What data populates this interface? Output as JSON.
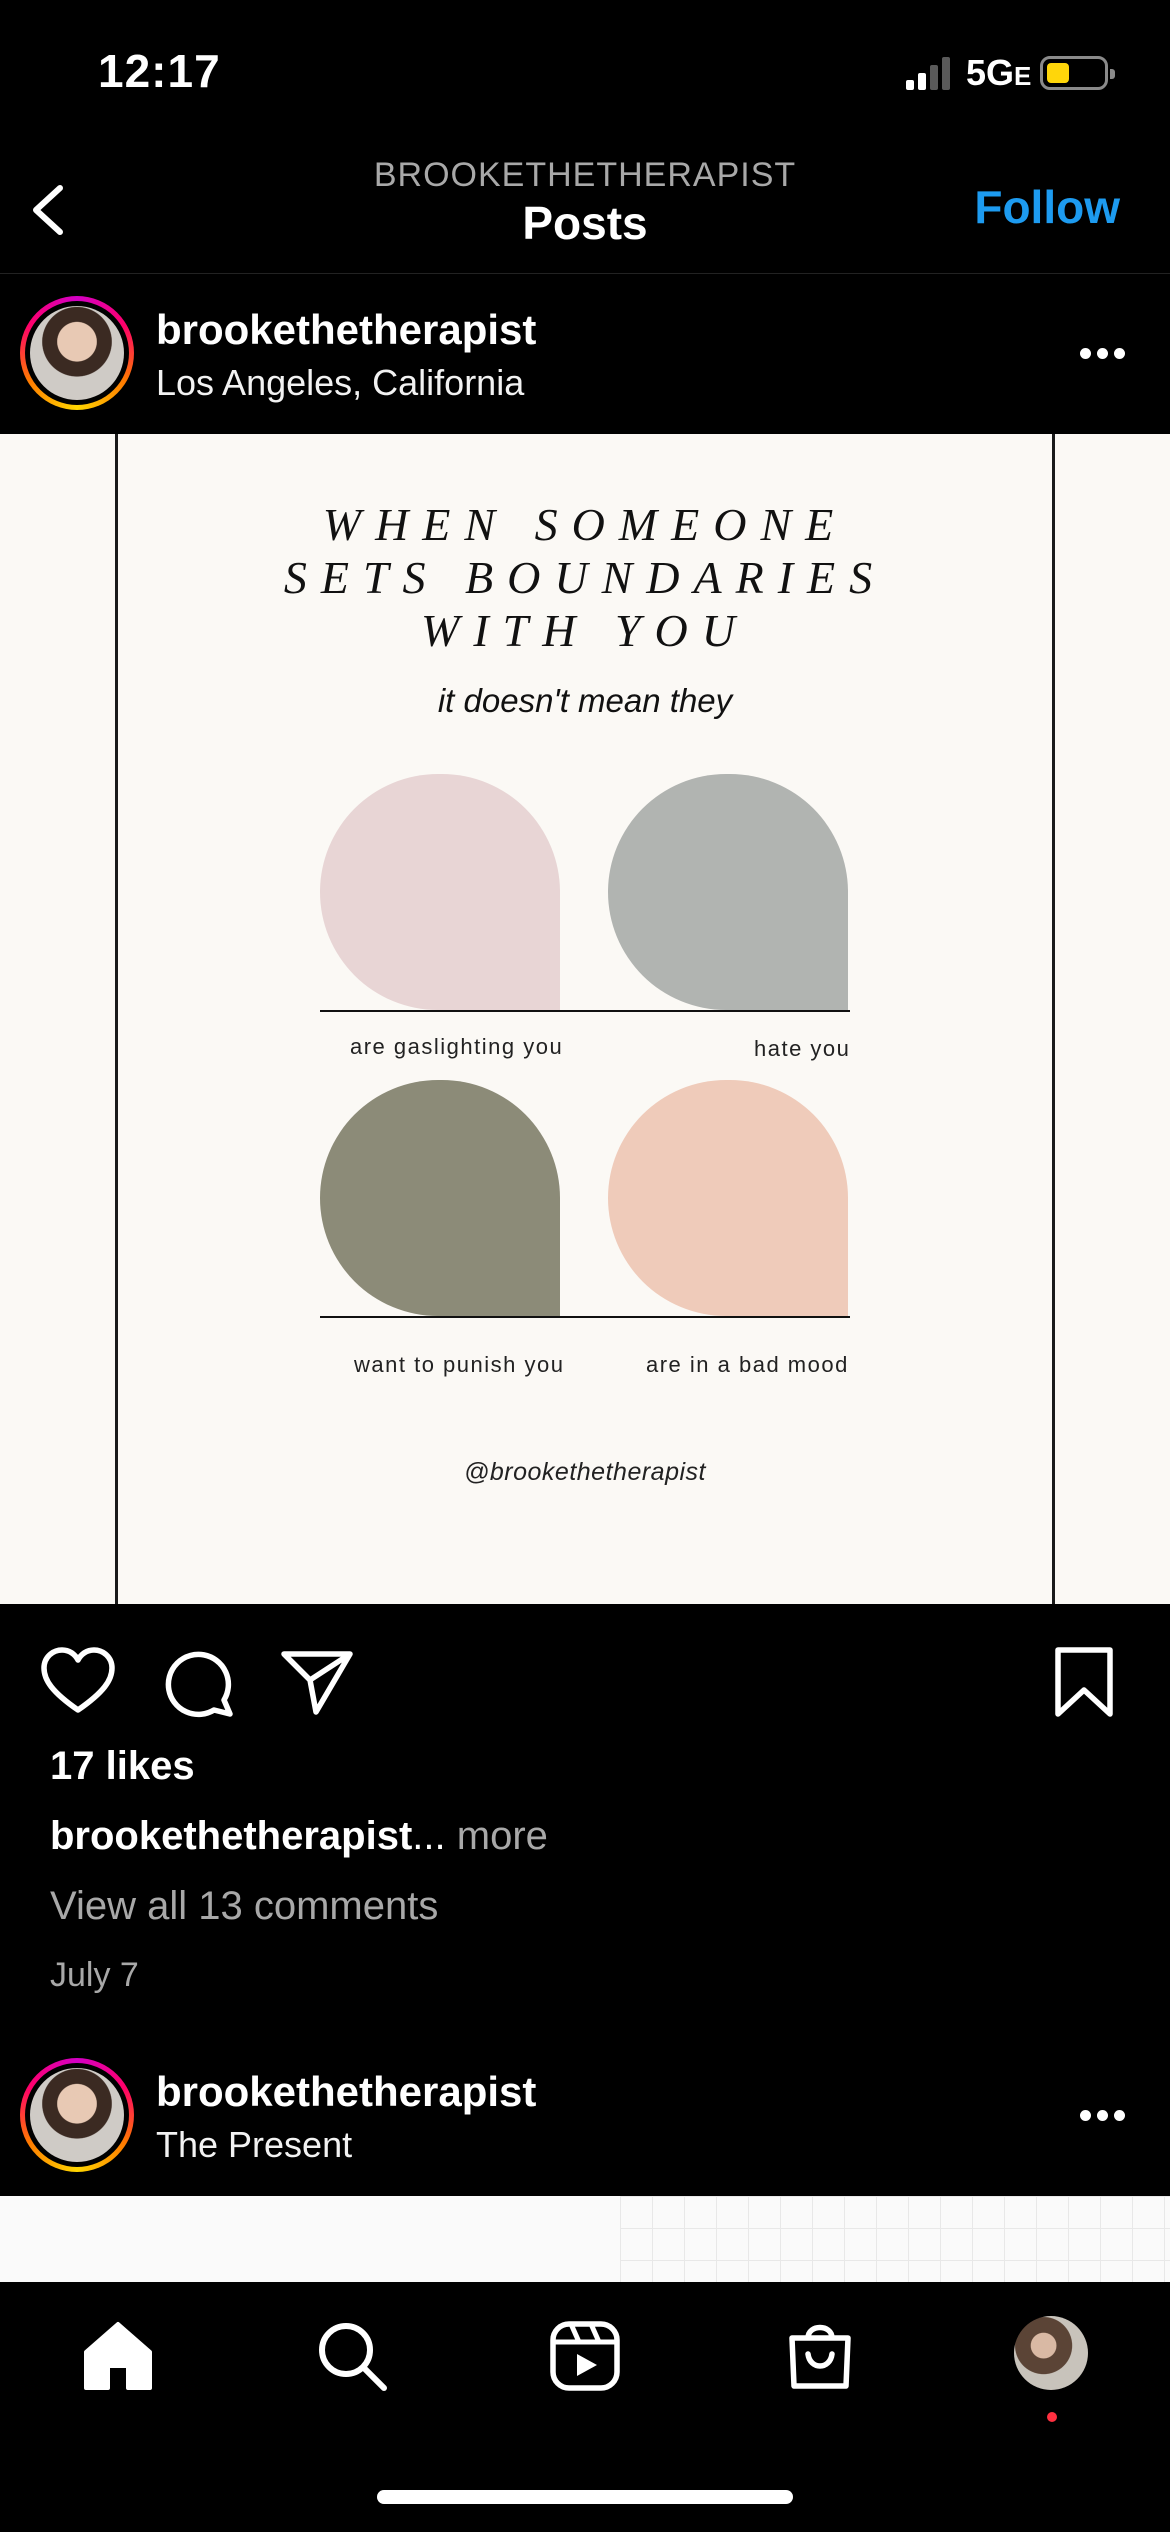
{
  "status_bar": {
    "time": "12:17",
    "network": "5G",
    "network_suffix": "E",
    "battery_color": "#ffd60a"
  },
  "header": {
    "account": "BROOKETHETHERAPIST",
    "title": "Posts",
    "follow_label": "Follow",
    "follow_color": "#1d9bf0"
  },
  "post": {
    "username": "brookethetherapist",
    "location": "Los Angeles, California",
    "image": {
      "title_lines": [
        "WHEN SOMEONE",
        "SETS BOUNDARIES",
        "WITH YOU"
      ],
      "subtitle": "it doesn't mean they",
      "captions": [
        "are gaslighting you",
        "hate you",
        "want to punish you",
        "are in a bad mood"
      ],
      "arch_colors": [
        "#e8d5d5",
        "#b1b4b1",
        "#8c8b78",
        "#efcbba"
      ],
      "handle": "@brookethetherapist"
    },
    "likes": "17 likes",
    "caption_user": "brookethetherapist",
    "caption_ellipsis": "...",
    "caption_more": " more",
    "comments": "View all 13 comments",
    "date": "July 7"
  },
  "next_post": {
    "username": "brookethetherapist",
    "location": "The Present"
  },
  "tabbar": {
    "icons": [
      "home-icon",
      "search-icon",
      "reels-icon",
      "shop-icon",
      "profile-avatar"
    ],
    "notification_color": "#ff3040"
  }
}
